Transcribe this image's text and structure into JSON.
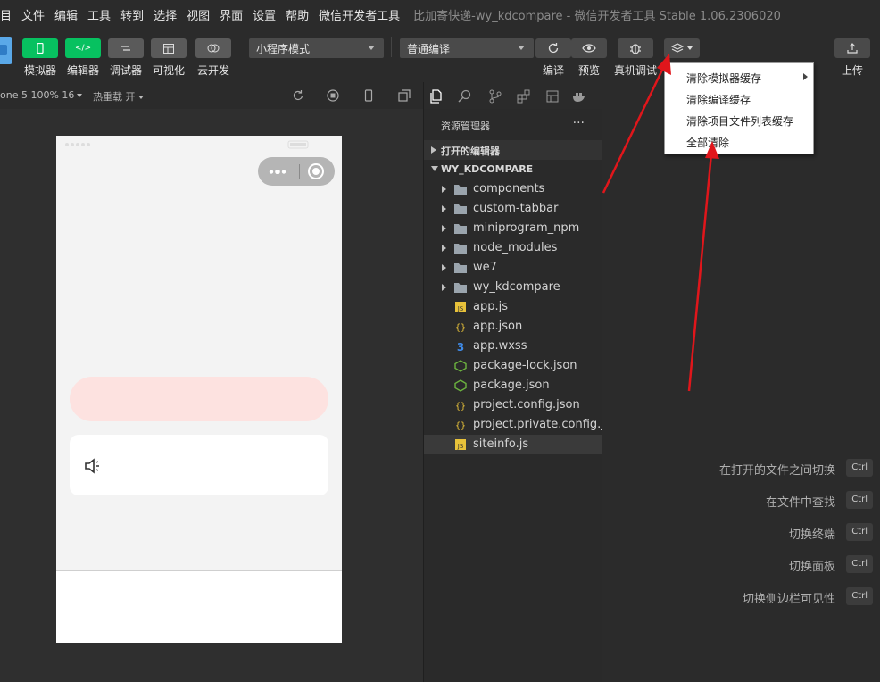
{
  "menubar": {
    "items": [
      "目",
      "文件",
      "编辑",
      "工具",
      "转到",
      "选择",
      "视图",
      "界面",
      "设置",
      "帮助",
      "微信开发者工具"
    ],
    "window_title": "比加寄快递-wy_kdcompare - 微信开发者工具 Stable 1.06.2306020"
  },
  "toolbar": {
    "simulator_label": "模拟器",
    "editor_label": "编辑器",
    "debugger_label": "调试器",
    "visual_label": "可视化",
    "cloud_label": "云开发",
    "mode_select": "小程序模式",
    "compile_select": "普通编译",
    "compile_label": "编译",
    "preview_label": "预览",
    "realdebug_label": "真机调试",
    "upload_label": "上传"
  },
  "simulator": {
    "device_label": "one 5 100% 16",
    "hot_reload_label": "热重载 开"
  },
  "explorer": {
    "title": "资源管理器",
    "more": "···",
    "section_open_editors": "打开的编辑器",
    "section_project": "WY_KDCOMPARE",
    "items": [
      {
        "name": "components",
        "icon": "folder-icon",
        "folder": true
      },
      {
        "name": "custom-tabbar",
        "icon": "folder-icon",
        "folder": true
      },
      {
        "name": "miniprogram_npm",
        "icon": "folder-icon",
        "folder": true
      },
      {
        "name": "node_modules",
        "icon": "folder-icon",
        "folder": true
      },
      {
        "name": "we7",
        "icon": "folder-icon",
        "folder": true
      },
      {
        "name": "wy_kdcompare",
        "icon": "folder-icon",
        "folder": true
      },
      {
        "name": "app.js",
        "icon": "js-icon",
        "folder": false
      },
      {
        "name": "app.json",
        "icon": "json-icon",
        "folder": false
      },
      {
        "name": "app.wxss",
        "icon": "css-icon",
        "folder": false
      },
      {
        "name": "package-lock.json",
        "icon": "node-icon",
        "folder": false
      },
      {
        "name": "package.json",
        "icon": "node-icon",
        "folder": false
      },
      {
        "name": "project.config.json",
        "icon": "json-icon",
        "folder": false
      },
      {
        "name": "project.private.config.js...",
        "icon": "json-icon",
        "folder": false
      },
      {
        "name": "siteinfo.js",
        "icon": "js-icon",
        "folder": false
      }
    ]
  },
  "editor": {
    "shortcuts": [
      {
        "label": "在打开的文件之间切换",
        "key": "Ctrl"
      },
      {
        "label": "在文件中查找",
        "key": "Ctrl"
      },
      {
        "label": "切换终端",
        "key": "Ctrl"
      },
      {
        "label": "切换面板",
        "key": "Ctrl"
      },
      {
        "label": "切换侧边栏可见性",
        "key": "Ctrl"
      }
    ]
  },
  "dropdown": {
    "items": [
      "清除模拟器缓存",
      "清除编译缓存",
      "清除项目文件列表缓存",
      "全部清除"
    ]
  },
  "colors": {
    "accent_green": "#07c160",
    "annotation_red": "#e0161b"
  }
}
